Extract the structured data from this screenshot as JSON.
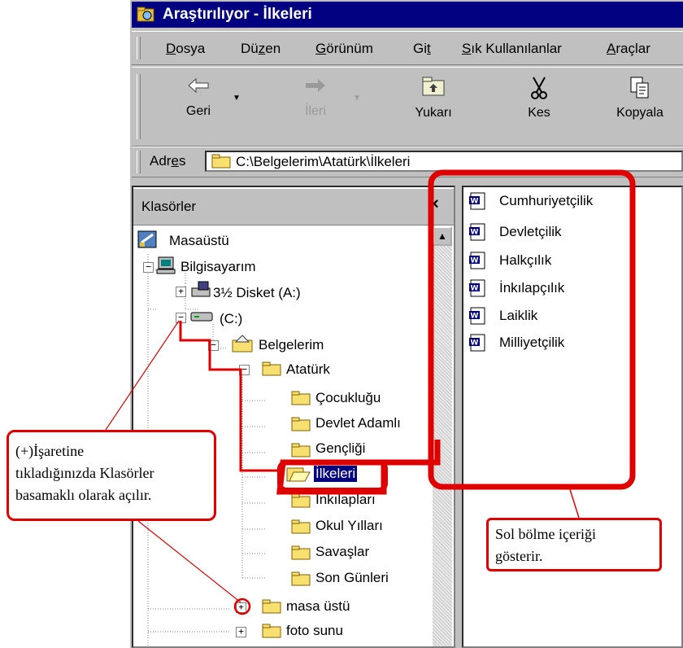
{
  "window": {
    "title": "Araştırılıyor - İlkeleri"
  },
  "menu": [
    {
      "label": "Dosya",
      "key": "D",
      "rest": "osya"
    },
    {
      "label": "Düzen",
      "key": "z",
      "pre": "Dü",
      "rest": "en"
    },
    {
      "label": "Görünüm",
      "key": "G",
      "rest": "örünüm"
    },
    {
      "label": "Git",
      "key": "t",
      "pre": "Gi",
      "rest": ""
    },
    {
      "label": "Sık Kullanılanlar",
      "key": "S",
      "rest": "ık Kullanılanlar"
    },
    {
      "label": "Araçlar",
      "key": "A",
      "rest": "raçlar"
    }
  ],
  "toolbar": {
    "back": "Geri",
    "forward": "İleri",
    "up": "Yukarı",
    "cut": "Kes",
    "copy": "Kopyala"
  },
  "address": {
    "label_pre": "Adr",
    "label_key": "e",
    "label_rest": "s",
    "path": "C:\\Belgelerim\\Atatürk\\İlkeleri"
  },
  "folders_pane": {
    "header": "Klasörler",
    "close": "×"
  },
  "tree": {
    "desktop": "Masaüstü",
    "computer": "Bilgisayarım",
    "floppy": "3½ Disket (A:)",
    "drive_c": "(C:)",
    "documents": "Belgelerim",
    "ataturk": "Atatürk",
    "children": [
      "Çocukluğu",
      "Devlet Adamlı",
      "Gençliği",
      "İlkeleri",
      "İnkılapları",
      "Okul Yılları",
      "Savaşlar",
      "Son Günleri"
    ],
    "selected": "İlkeleri",
    "masa_ustu": "masa üstü",
    "foto_sunu": "foto sunu"
  },
  "files": [
    "Cumhuriyetçilik",
    "Devletçilik",
    "Halkçılık",
    "İnkılapçılık",
    "Laiklik",
    "Milliyetçilik"
  ],
  "callouts": {
    "left": [
      "(+)İşaretine",
      "tıkladığınızda Klasörler",
      "basamaklı olarak açılır."
    ],
    "right": [
      "Sol bölme içeriği",
      "gösterir."
    ]
  },
  "colors": {
    "titlebar": "#000080",
    "annotation": "#e00000",
    "selection": "#000080"
  }
}
